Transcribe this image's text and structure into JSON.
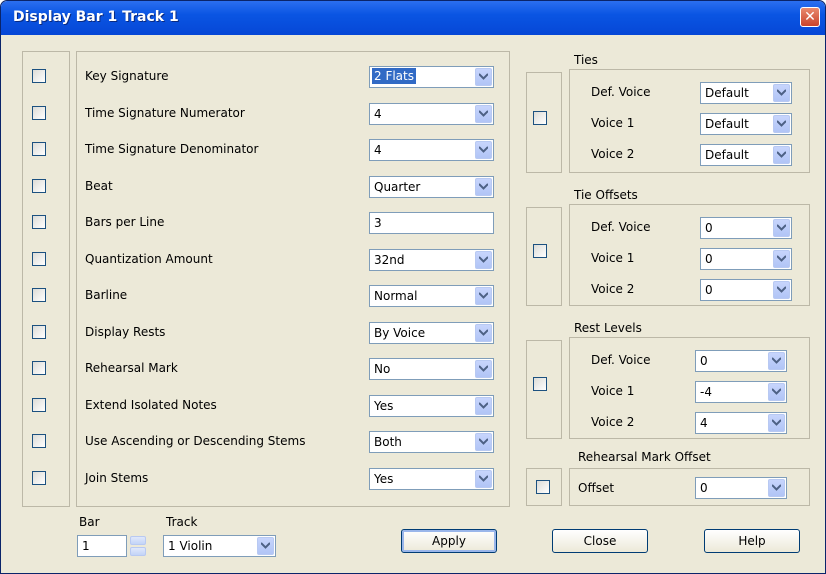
{
  "window": {
    "title": "Display Bar 1 Track 1",
    "close_glyph": "✕"
  },
  "settings": [
    {
      "label": "Key Signature",
      "value": "2 Flats",
      "control": "dropdown",
      "highlighted": true
    },
    {
      "label": "Time Signature Numerator",
      "value": "4",
      "control": "dropdown"
    },
    {
      "label": "Time Signature Denominator",
      "value": "4",
      "control": "dropdown"
    },
    {
      "label": "Beat",
      "value": "Quarter",
      "control": "dropdown"
    },
    {
      "label": "Bars per Line",
      "value": "3",
      "control": "text"
    },
    {
      "label": "Quantization Amount",
      "value": "32nd",
      "control": "dropdown"
    },
    {
      "label": "Barline",
      "value": "Normal",
      "control": "dropdown"
    },
    {
      "label": "Display Rests",
      "value": "By Voice",
      "control": "dropdown"
    },
    {
      "label": "Rehearsal Mark",
      "value": "No",
      "control": "dropdown"
    },
    {
      "label": "Extend Isolated Notes",
      "value": "Yes",
      "control": "dropdown"
    },
    {
      "label": "Use Ascending or Descending Stems",
      "value": "Both",
      "control": "dropdown"
    },
    {
      "label": "Join Stems",
      "value": "Yes",
      "control": "dropdown"
    }
  ],
  "ties": {
    "title": "Ties",
    "rows": [
      {
        "label": "Def. Voice",
        "value": "Default"
      },
      {
        "label": "Voice 1",
        "value": "Default"
      },
      {
        "label": "Voice 2",
        "value": "Default"
      }
    ]
  },
  "tie_offsets": {
    "title": "Tie Offsets",
    "rows": [
      {
        "label": "Def. Voice",
        "value": "0"
      },
      {
        "label": "Voice 1",
        "value": "0"
      },
      {
        "label": "Voice 2",
        "value": "0"
      }
    ]
  },
  "rest_levels": {
    "title": "Rest Levels",
    "rows": [
      {
        "label": "Def. Voice",
        "value": "0"
      },
      {
        "label": "Voice 1",
        "value": "-4"
      },
      {
        "label": "Voice 2",
        "value": "4"
      }
    ]
  },
  "rehearsal_offset": {
    "title": "Rehearsal Mark Offset",
    "label": "Offset",
    "value": "0"
  },
  "footer": {
    "bar_label": "Bar",
    "bar_value": "1",
    "track_label": "Track",
    "track_value": "1 Violin",
    "apply": "Apply",
    "close": "Close",
    "help": "Help"
  },
  "colors": {
    "titlebar": "#0a55e3",
    "dialog_bg": "#ece9d8",
    "selection": "#316ac5",
    "close_button": "#c9432a"
  }
}
